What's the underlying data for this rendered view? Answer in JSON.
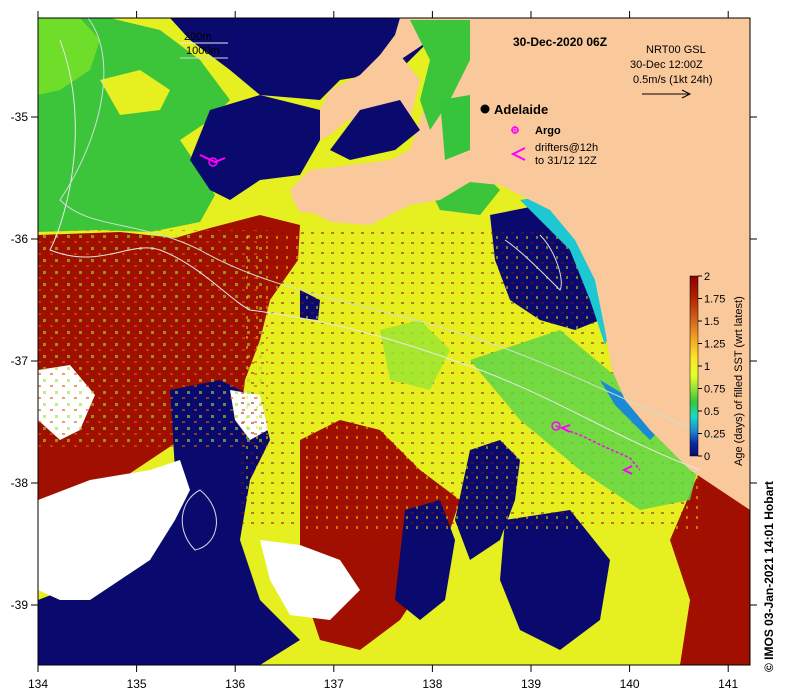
{
  "title": "30-Dec-2020 06Z",
  "product": {
    "line1": "NRT00 GSL",
    "line2": "30-Dec 12:00Z",
    "line3": "0.5m/s (1kt 24h)"
  },
  "contours": {
    "c200": "200m",
    "c1000": "1000m"
  },
  "city": {
    "name": "Adelaide"
  },
  "legend": {
    "argo": "Argo",
    "drifters_line1": "drifters@12h",
    "drifters_line2": "to 31/12 12Z"
  },
  "colorbar": {
    "title": "Age (days) of filled SST (wrt latest)",
    "ticks": [
      "2",
      "1.75",
      "1.5",
      "1.25",
      "1",
      "0.75",
      "0.5",
      "0.25",
      "0"
    ],
    "colors": [
      "#8b0000",
      "#b22200",
      "#d2691e",
      "#f5a623",
      "#fde12a",
      "#e8ff2a",
      "#c8f22a",
      "#9be534",
      "#36c43c",
      "#19d9c6",
      "#1a8ad4",
      "#0b2aa3",
      "#08086e"
    ]
  },
  "axes": {
    "x_ticks": [
      "134",
      "135",
      "136",
      "137",
      "138",
      "139",
      "140",
      "141"
    ],
    "y_ticks": [
      "-35",
      "-36",
      "-37",
      "-38",
      "-39"
    ]
  },
  "credit": "© IMOS 03-Jan-2021 14:01 Hobart",
  "colors": {
    "land": "#f9c89b",
    "deep_navy": "#0a0a6e",
    "dark_red": "#a10f00",
    "yellow": "#f0f000",
    "green": "#36c43c",
    "cyan": "#1ec8d2",
    "white": "#ffffff",
    "magenta": "#ff00ff"
  }
}
